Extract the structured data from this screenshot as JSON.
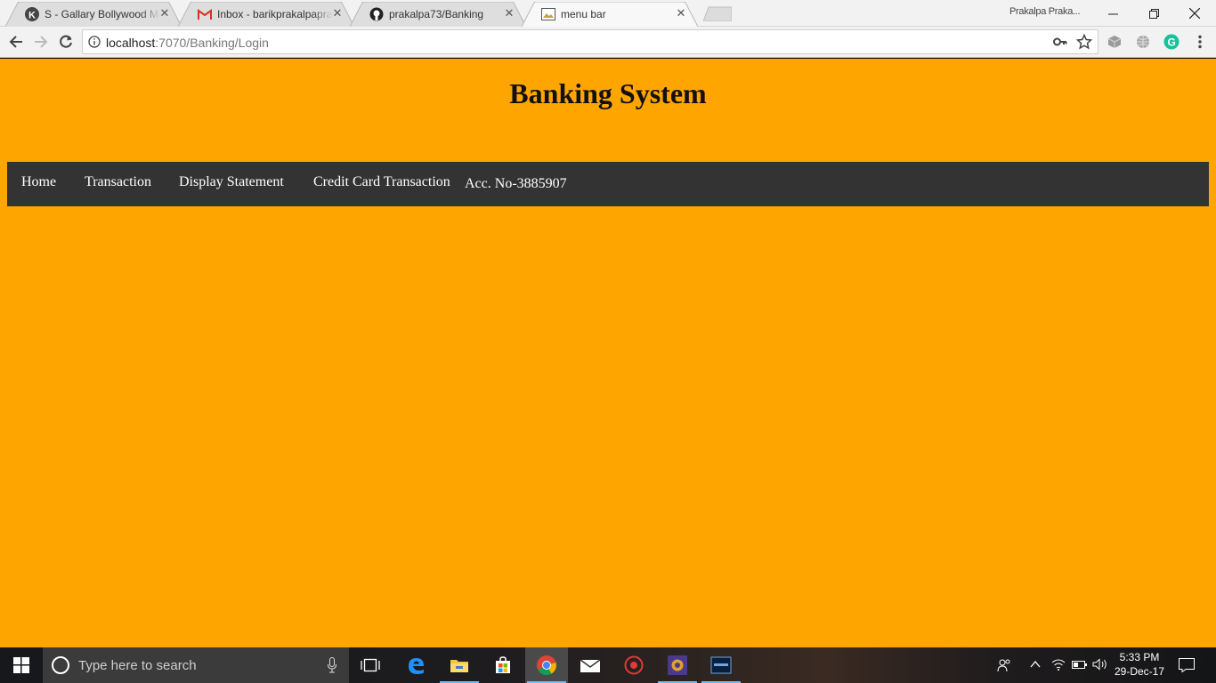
{
  "browser": {
    "tabs": [
      {
        "title": "S - Gallary Bollywood Mo",
        "favicon": "k-logo-icon",
        "active": false
      },
      {
        "title": "Inbox - barikprakalpaprak",
        "favicon": "gmail-icon",
        "active": false
      },
      {
        "title": "prakalpa73/Banking",
        "favicon": "github-icon",
        "active": false
      },
      {
        "title": "menu bar",
        "favicon": "page-image-icon",
        "active": true
      }
    ],
    "profile_name": "Prakalpa Praka...",
    "address": {
      "host": "localhost",
      "path": ":7070/Banking/Login"
    }
  },
  "page": {
    "title": "Banking System",
    "menu": [
      "Home",
      "Transaction",
      "Display Statement",
      "Credit Card Transaction"
    ],
    "account": "Acc. No-3885907",
    "background_color": "#ffa500",
    "menu_color": "#333333"
  },
  "taskbar": {
    "search_placeholder": "Type here to search",
    "time": "5:33 PM",
    "date": "29-Dec-17"
  }
}
